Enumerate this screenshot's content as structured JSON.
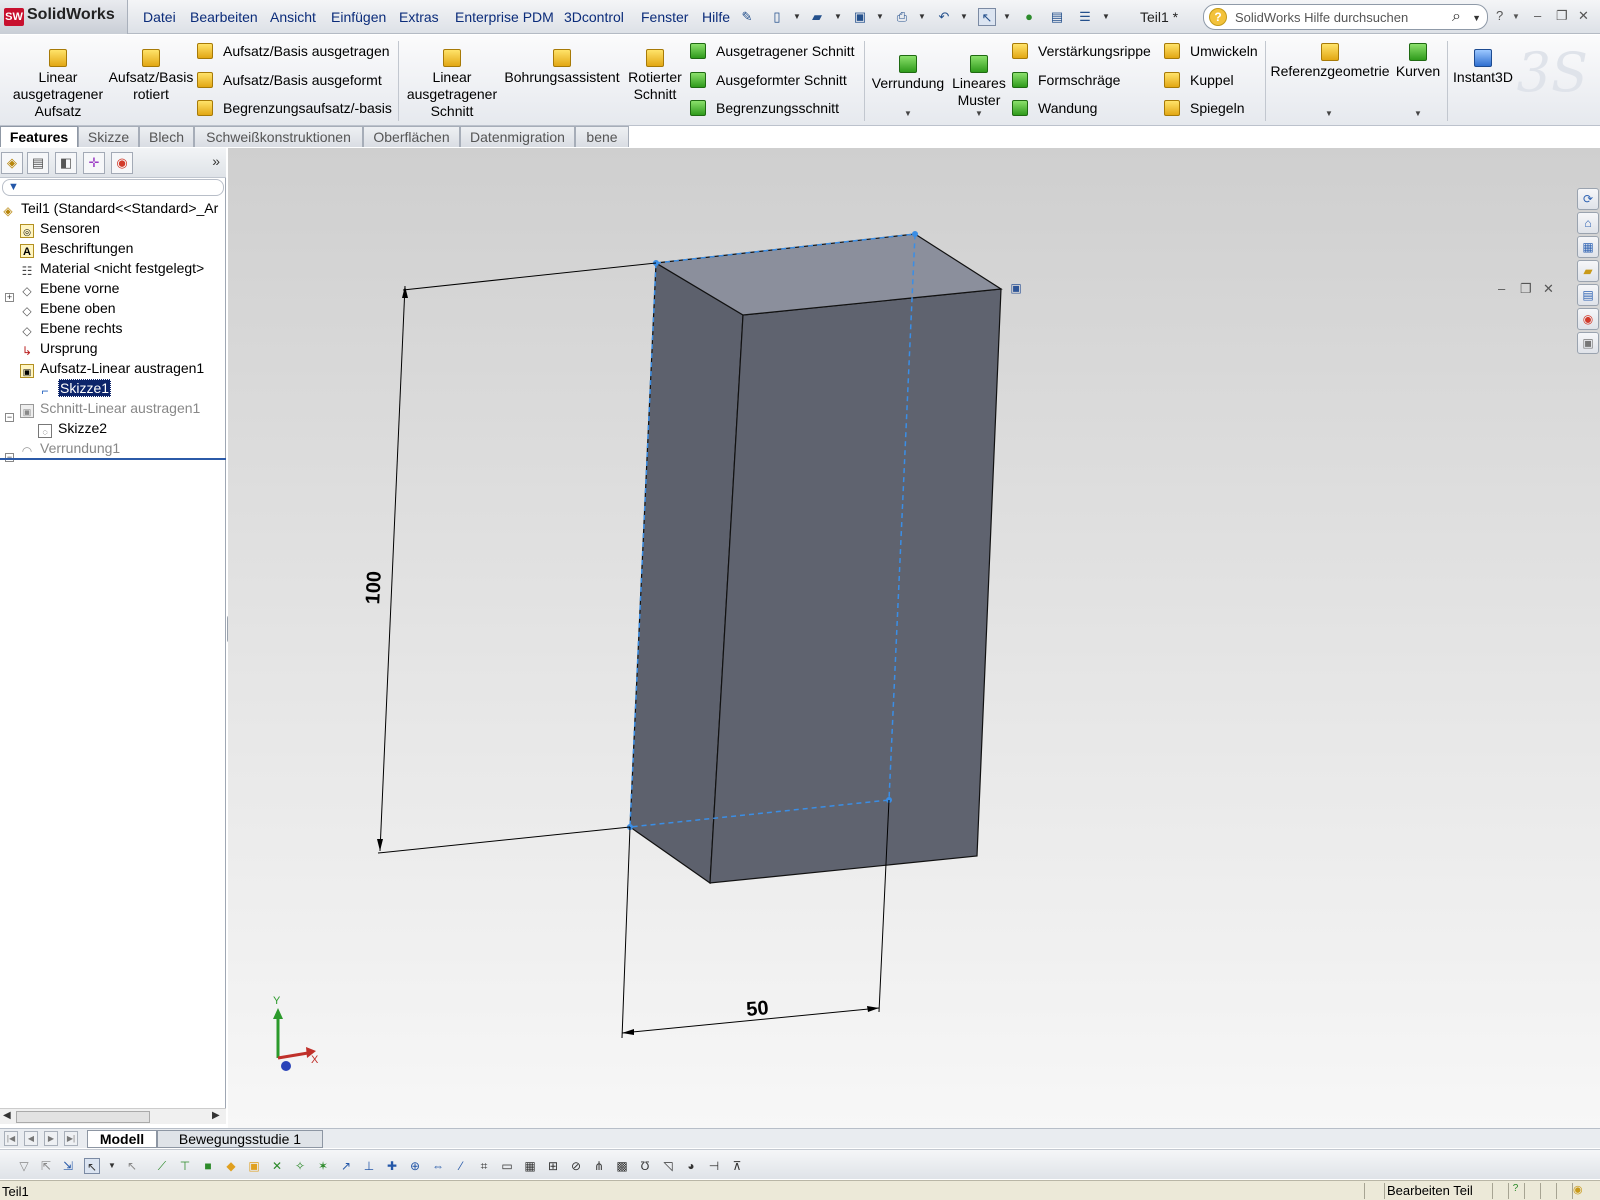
{
  "app": {
    "logo_mark": "SW",
    "logo_text": "SolidWorks",
    "document_title": "Teil1 *"
  },
  "menu": [
    "Datei",
    "Bearbeiten",
    "Ansicht",
    "Einfügen",
    "Extras",
    "Enterprise PDM",
    "3Dcontrol",
    "Fenster",
    "Hilfe"
  ],
  "help_search": {
    "placeholder": "SolidWorks Hilfe durchsuchen"
  },
  "ribbon": {
    "linear_boss": "Linear ausgetragener Aufsatz",
    "revolved_boss": "Aufsatz/Basis rotiert",
    "swept_boss": "Aufsatz/Basis ausgetragen",
    "lofted_boss": "Aufsatz/Basis ausgeformt",
    "boundary_boss": "Begrenzungsaufsatz/-basis",
    "extruded_cut": "Linear ausgetragener Schnitt",
    "hole_wizard": "Bohrungsassistent",
    "revolved_cut": "Rotierter Schnitt",
    "swept_cut": "Ausgetragener Schnitt",
    "lofted_cut": "Ausgeformter Schnitt",
    "boundary_cut": "Begrenzungsschnitt",
    "fillet": "Verrundung",
    "linear_pattern": "Lineares Muster",
    "rib": "Verstärkungsrippe",
    "draft": "Formschräge",
    "shell": "Wandung",
    "wrap": "Umwickeln",
    "dome": "Kuppel",
    "mirror": "Spiegeln",
    "ref_geometry": "Referenzgeometrie",
    "curves": "Kurven",
    "instant3d": "Instant3D"
  },
  "command_tabs": [
    "Features",
    "Skizze",
    "Blech",
    "Schweißkonstruktionen",
    "Oberflächen",
    "Datenmigration",
    "bene"
  ],
  "tree": {
    "root": "Teil1  (Standard<<Standard>_Ar",
    "items": [
      "Sensoren",
      "Beschriftungen",
      "Material <nicht festgelegt>",
      "Ebene vorne",
      "Ebene oben",
      "Ebene rechts",
      "Ursprung",
      "Aufsatz-Linear austragen1",
      "Skizze1",
      "Schnitt-Linear austragen1",
      "Skizze2",
      "Verrundung1"
    ]
  },
  "dimensions": {
    "height": "100",
    "width": "50"
  },
  "triad": {
    "x": "X",
    "y": "Y"
  },
  "bottom_tabs": [
    "Modell",
    "Bewegungsstudie 1"
  ],
  "status": {
    "left": "Teil1",
    "mode": "Bearbeiten Teil"
  },
  "colors": {
    "model_side": "#5d616d",
    "model_top": "#8b8f9c",
    "sketch_blue": "#3a8ee6",
    "tree_selection": "#0c246a"
  },
  "icons": [
    "solidworks-logo-icon",
    "new-icon",
    "open-icon",
    "save-icon",
    "print-icon",
    "undo-icon",
    "select-icon",
    "rebuild-icon",
    "options-icon",
    "help-icon",
    "search-icon"
  ]
}
